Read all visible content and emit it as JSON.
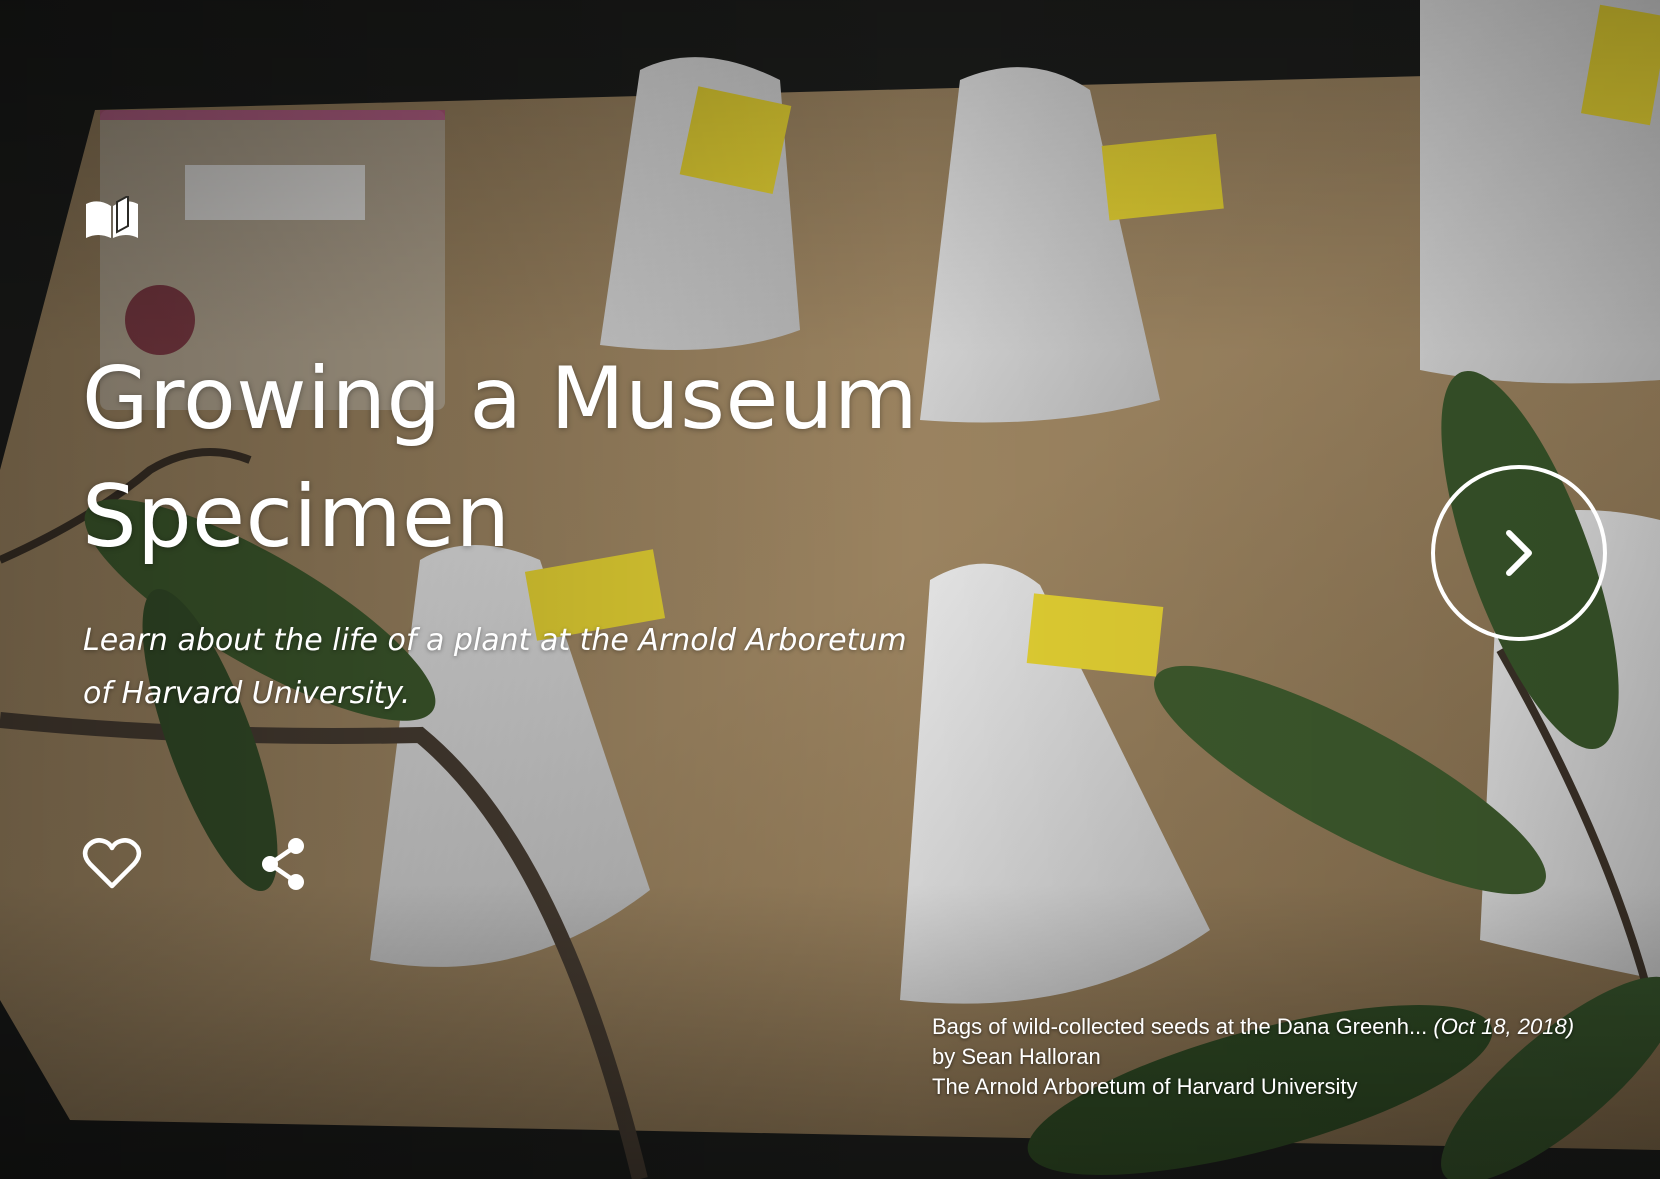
{
  "story": {
    "title": "Growing a Museum Specimen",
    "subtitle": "Learn about the life of a plant at the Arnold Arboretum of Harvard University."
  },
  "icons": {
    "story": "open-book-icon",
    "like": "heart-outline-icon",
    "share": "share-icon",
    "next": "chevron-right-icon"
  },
  "caption": {
    "description": "Bags of wild-collected seeds at the Dana Greenh...",
    "date": "(Oct 18, 2018)",
    "author": "by Sean Halloran",
    "institution": "The Arnold Arboretum of Harvard University"
  },
  "colors": {
    "paper": "#a08560",
    "bag": "#e6e6e6",
    "tag": "#f0e23c",
    "leaf": "#3d5a2c"
  }
}
